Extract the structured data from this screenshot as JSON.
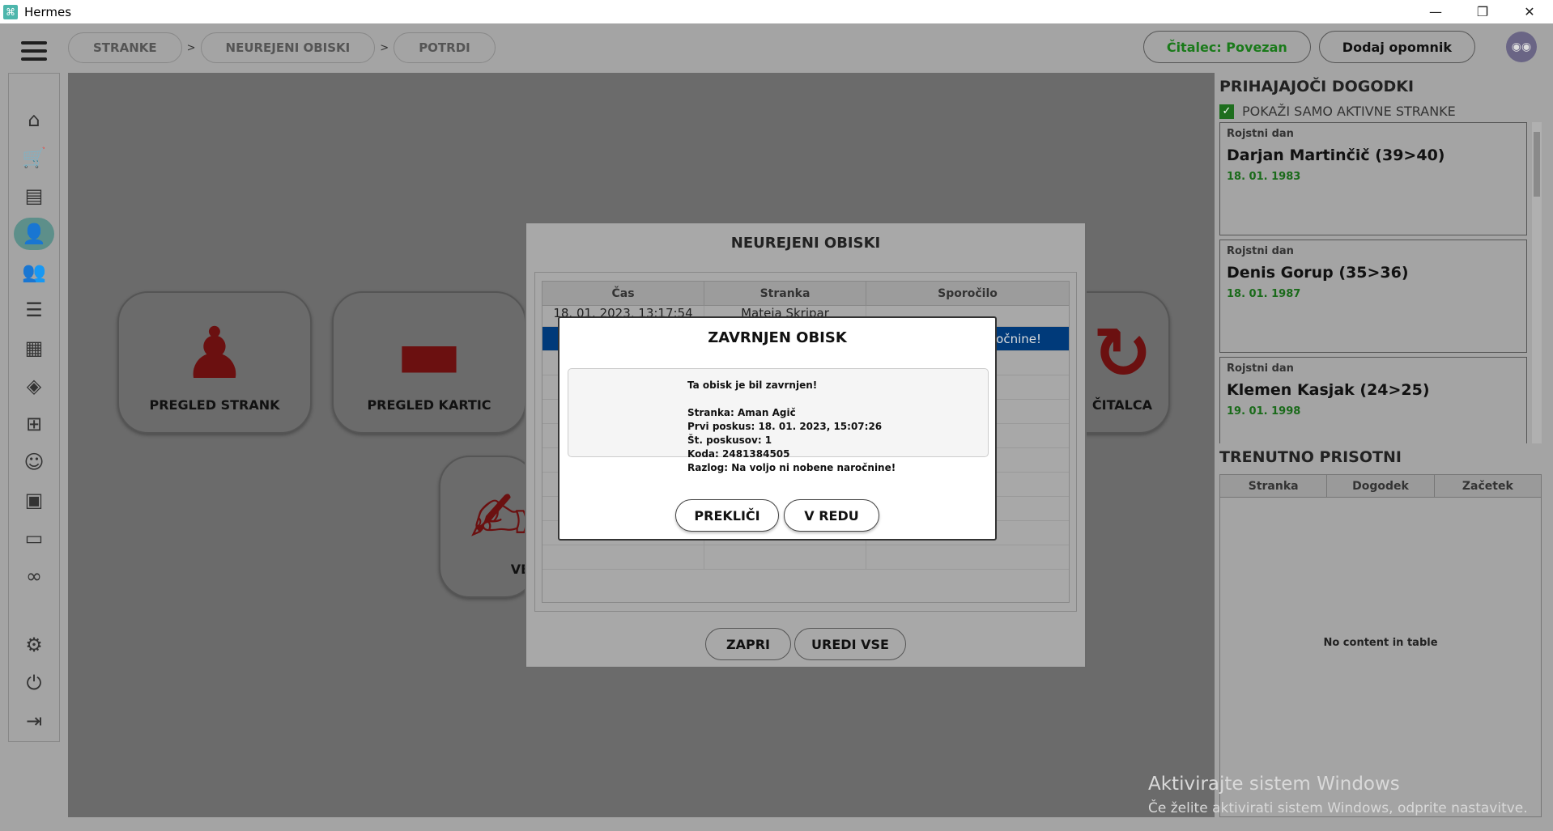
{
  "window": {
    "title": "Hermes",
    "minimize_glyph": "—",
    "maximize_glyph": "❐",
    "close_glyph": "✕"
  },
  "breadcrumbs": [
    "STRANKE",
    "NEUREJENI OBISKI",
    "POTRDI"
  ],
  "breadcrumb_sep": ">",
  "header": {
    "reader_status": "Čitalec: Povezan",
    "add_reminder": "Dodaj opomnik"
  },
  "sidebar": {
    "items": [
      {
        "name": "home-icon",
        "glyph": "⌂"
      },
      {
        "name": "cart-icon",
        "glyph": "🛒"
      },
      {
        "name": "document-icon",
        "glyph": "▤"
      },
      {
        "name": "user-icon",
        "glyph": "👤"
      },
      {
        "name": "users-icon",
        "glyph": "👥"
      },
      {
        "name": "list-icon",
        "glyph": "☰"
      },
      {
        "name": "calendar-icon",
        "glyph": "▦"
      },
      {
        "name": "layers-icon",
        "glyph": "◈"
      },
      {
        "name": "network-icon",
        "glyph": "⊞"
      },
      {
        "name": "staff-icon",
        "glyph": "☺"
      },
      {
        "name": "briefcase-icon",
        "glyph": "▣"
      },
      {
        "name": "chat-icon",
        "glyph": "▭"
      },
      {
        "name": "handshake-icon",
        "glyph": "∞"
      },
      {
        "name": "settings-icon",
        "glyph": "⚙"
      },
      {
        "name": "power-icon",
        "glyph": "⏻"
      },
      {
        "name": "logout-icon",
        "glyph": "⇥"
      }
    ]
  },
  "tiles": {
    "pregled_strank": "PREGLED STRANK",
    "pregled_kartic": "PREGLED KARTIC",
    "citalca_partial": "ČITALCA",
    "ve_partial": "VE"
  },
  "right_panel": {
    "events_title": "PRIHAJAJOČI DOGODKI",
    "only_active_label": "POKAŽI SAMO AKTIVNE STRANKE",
    "events": [
      {
        "type": "Rojstni dan",
        "name": "Darjan Martinčič (39>40)",
        "date": "18. 01. 1983"
      },
      {
        "type": "Rojstni dan",
        "name": "Denis Gorup (35>36)",
        "date": "18. 01. 1987"
      },
      {
        "type": "Rojstni dan",
        "name": "Klemen Kasjak (24>25)",
        "date": "19. 01. 1998"
      }
    ],
    "present_title": "TRENUTNO PRISOTNI",
    "present_columns": [
      "Stranka",
      "Dogodek",
      "Začetek"
    ],
    "present_empty": "No content in table"
  },
  "dialog_visits": {
    "title": "NEUREJENI OBISKI",
    "columns": [
      "Čas",
      "Stranka",
      "Sporočilo"
    ],
    "rows": [
      {
        "cas": "18. 01. 2023, 13:17:54",
        "stranka": "Mateja Skripar",
        "sporocilo": ""
      },
      {
        "cas": "",
        "stranka": "",
        "sporocilo": "očnine!"
      }
    ],
    "close_btn": "ZAPRI",
    "edit_all_btn": "UREDI VSE"
  },
  "dialog_confirm": {
    "title": "ZAVRNJEN OBISK",
    "lines": [
      "Ta obisk je bil zavrnjen!",
      "",
      "Stranka: Aman Agič",
      "Prvi poskus: 18. 01. 2023, 15:07:26",
      "Št. poskusov: 1",
      "Koda: 2481384505",
      "Razlog: Na voljo ni nobene naročnine!"
    ],
    "cancel_btn": "PREKLIČI",
    "ok_btn": "V REDU"
  },
  "watermark": {
    "line1": "Aktivirajte sistem Windows",
    "line2": "Če želite aktivirati sistem Windows, odprite nastavitve."
  },
  "colors": {
    "reader_ok": "#1a7a1a",
    "tile_icon": "#6b1010",
    "selected_row": "#003a7a",
    "date_green": "#1a6a1a"
  }
}
